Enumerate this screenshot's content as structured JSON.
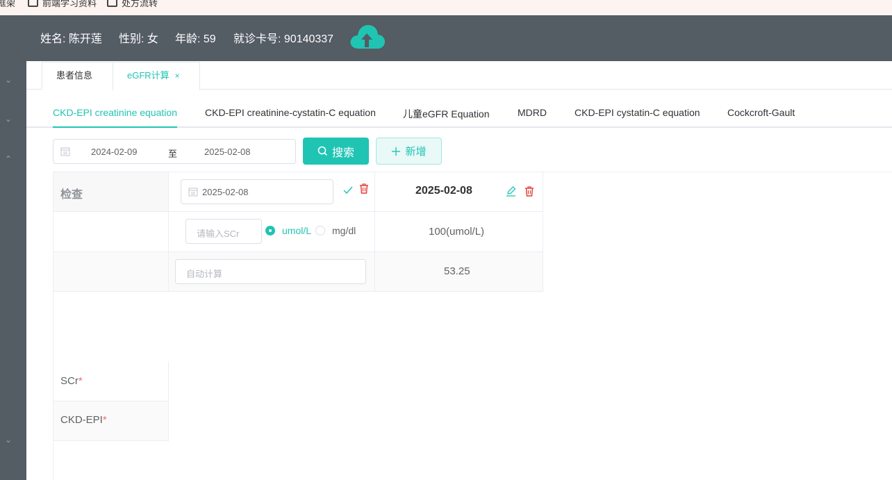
{
  "bookmarks": [
    {
      "label": "框架"
    },
    {
      "label": "前端学习资料"
    },
    {
      "label": "处方流转"
    }
  ],
  "patient": {
    "name": "姓名: 陈开莲",
    "gender": "性别: 女",
    "age": "年龄: 59",
    "card": "就诊卡号: 90140337"
  },
  "icons": {
    "upload": "cloud-upload-icon",
    "calendar": "calendar-icon",
    "check": "check-icon",
    "delete": "trash-icon",
    "edit": "edit-icon",
    "search": "search-icon",
    "plus": "plus-icon"
  },
  "colors": {
    "accent": "#20c4b3",
    "header": "#545c64",
    "danger": "#f56c6c"
  },
  "page_tabs": [
    {
      "label": "患者信息",
      "active": false
    },
    {
      "label": "eGFR计算",
      "active": true,
      "close": "×"
    }
  ],
  "equation_tabs": [
    {
      "label": "CKD-EPI creatinine equation",
      "active": true
    },
    {
      "label": "CKD-EPI creatinine-cystatin-C equation"
    },
    {
      "label": "儿童eGFR Equation"
    },
    {
      "label": "MDRD"
    },
    {
      "label": "CKD-EPI cystatin-C equation"
    },
    {
      "label": "Cockcroft-Gault"
    }
  ],
  "filter": {
    "start": "2024-02-09",
    "separator": "至",
    "end": "2025-02-08",
    "search_label": "搜索",
    "add_label": "新增"
  },
  "table": {
    "header_label": "检查",
    "new_col_date": "2025-02-08",
    "scr_placeholder": "请输入SCr",
    "unit_umol": "umol/L",
    "unit_mgdl": "mg/dl",
    "unit_selected": "umol/L",
    "auto_placeholder": "自动计算",
    "record_date": "2025-02-08",
    "record_scr": "100(umol/L)",
    "record_egfr": "53.25",
    "row_scr": "SCr",
    "row_ckd": "CKD-EPI",
    "required_mark": "*"
  }
}
